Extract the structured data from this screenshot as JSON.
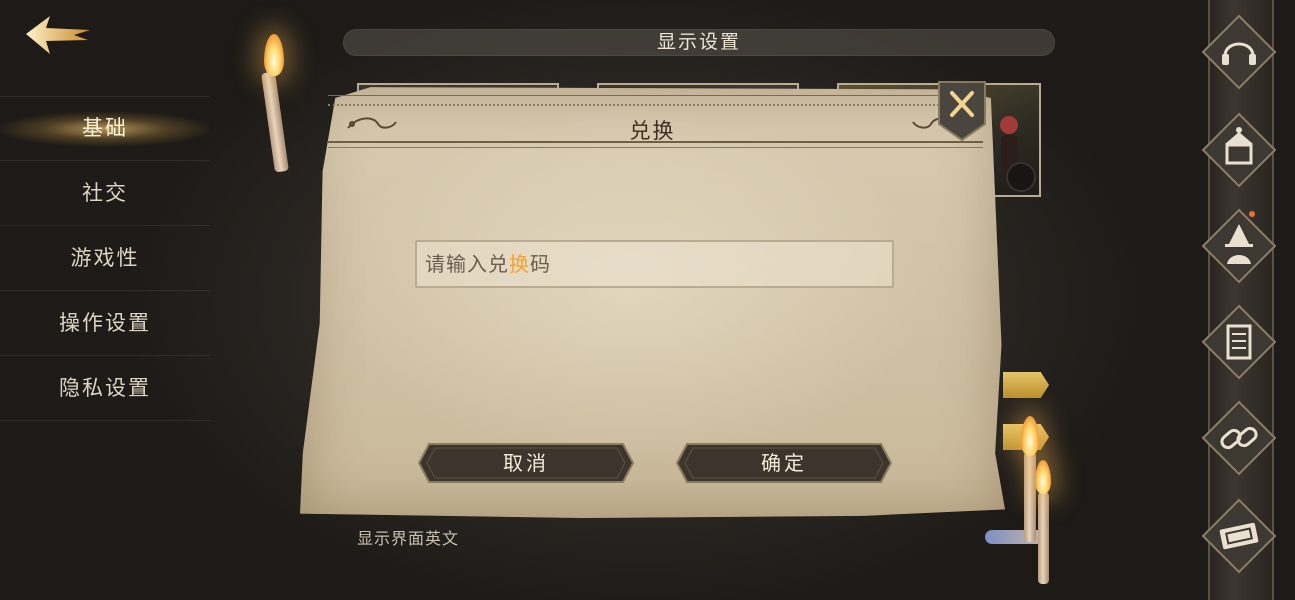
{
  "header": {
    "title": "显示设置"
  },
  "left_menu": {
    "items": [
      {
        "label": "基础",
        "active": true
      },
      {
        "label": "社交",
        "active": false
      },
      {
        "label": "游戏性",
        "active": false
      },
      {
        "label": "操作设置",
        "active": false
      },
      {
        "label": "隐私设置",
        "active": false
      }
    ]
  },
  "background": {
    "toggle_label": "显示界面英文"
  },
  "dialog": {
    "title": "兑换",
    "input": {
      "placeholder_prefix": "请输入兑",
      "placeholder_highlight": "换",
      "placeholder_suffix": "码"
    },
    "cancel_label": "取消",
    "confirm_label": "确定"
  },
  "right_rail": {
    "buttons": [
      "headset-icon",
      "shop-icon",
      "wizard-avatar-icon",
      "scroll-icon",
      "link-icon",
      "ticket-icon"
    ],
    "notification_color": "#e6713a"
  },
  "colors": {
    "accent_gold": "#e2b45c",
    "parchment": "#d2c4a8",
    "button_dark": "#3a342c"
  }
}
